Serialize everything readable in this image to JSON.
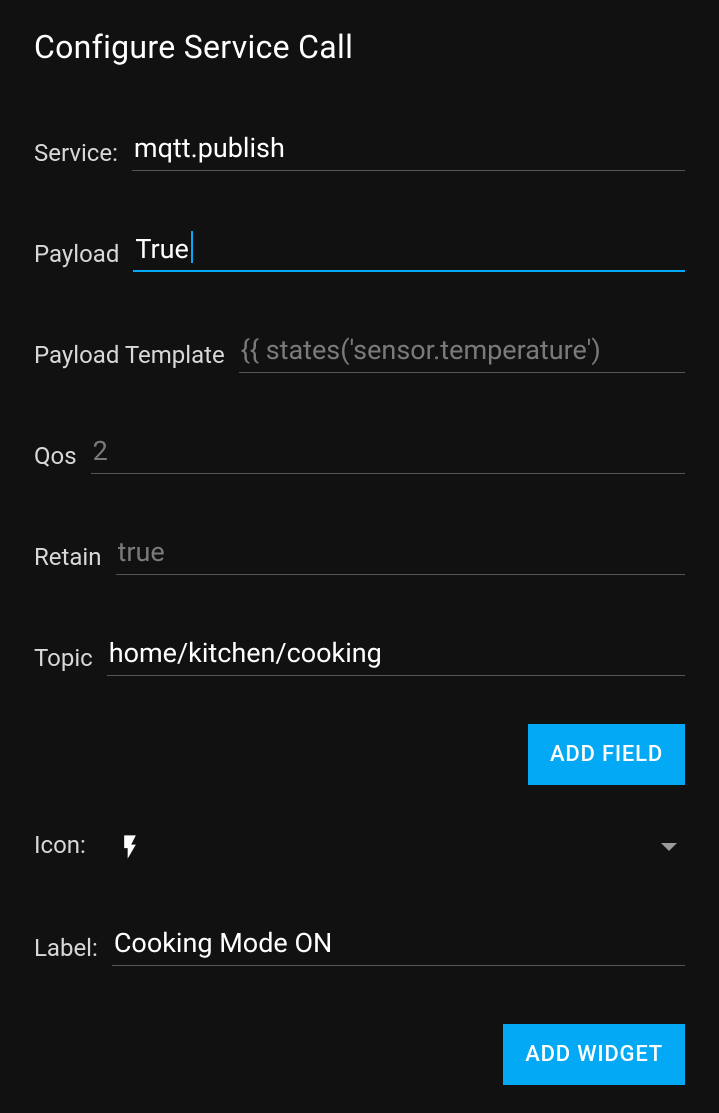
{
  "title": "Configure Service Call",
  "fields": {
    "service": {
      "label": "Service:",
      "value": "mqtt.publish"
    },
    "payload": {
      "label": "Payload",
      "value": "True"
    },
    "payloadTemplate": {
      "label": "Payload Template",
      "placeholder": "{{ states('sensor.temperature')"
    },
    "qos": {
      "label": "Qos",
      "placeholder": "2"
    },
    "retain": {
      "label": "Retain",
      "placeholder": "true"
    },
    "topic": {
      "label": "Topic",
      "value": "home/kitchen/cooking"
    },
    "icon": {
      "label": "Icon:",
      "value": "bolt"
    },
    "widgetLabel": {
      "label": "Label:",
      "value": "Cooking Mode ON"
    }
  },
  "buttons": {
    "addField": "ADD FIELD",
    "addWidget": "ADD WIDGET"
  }
}
